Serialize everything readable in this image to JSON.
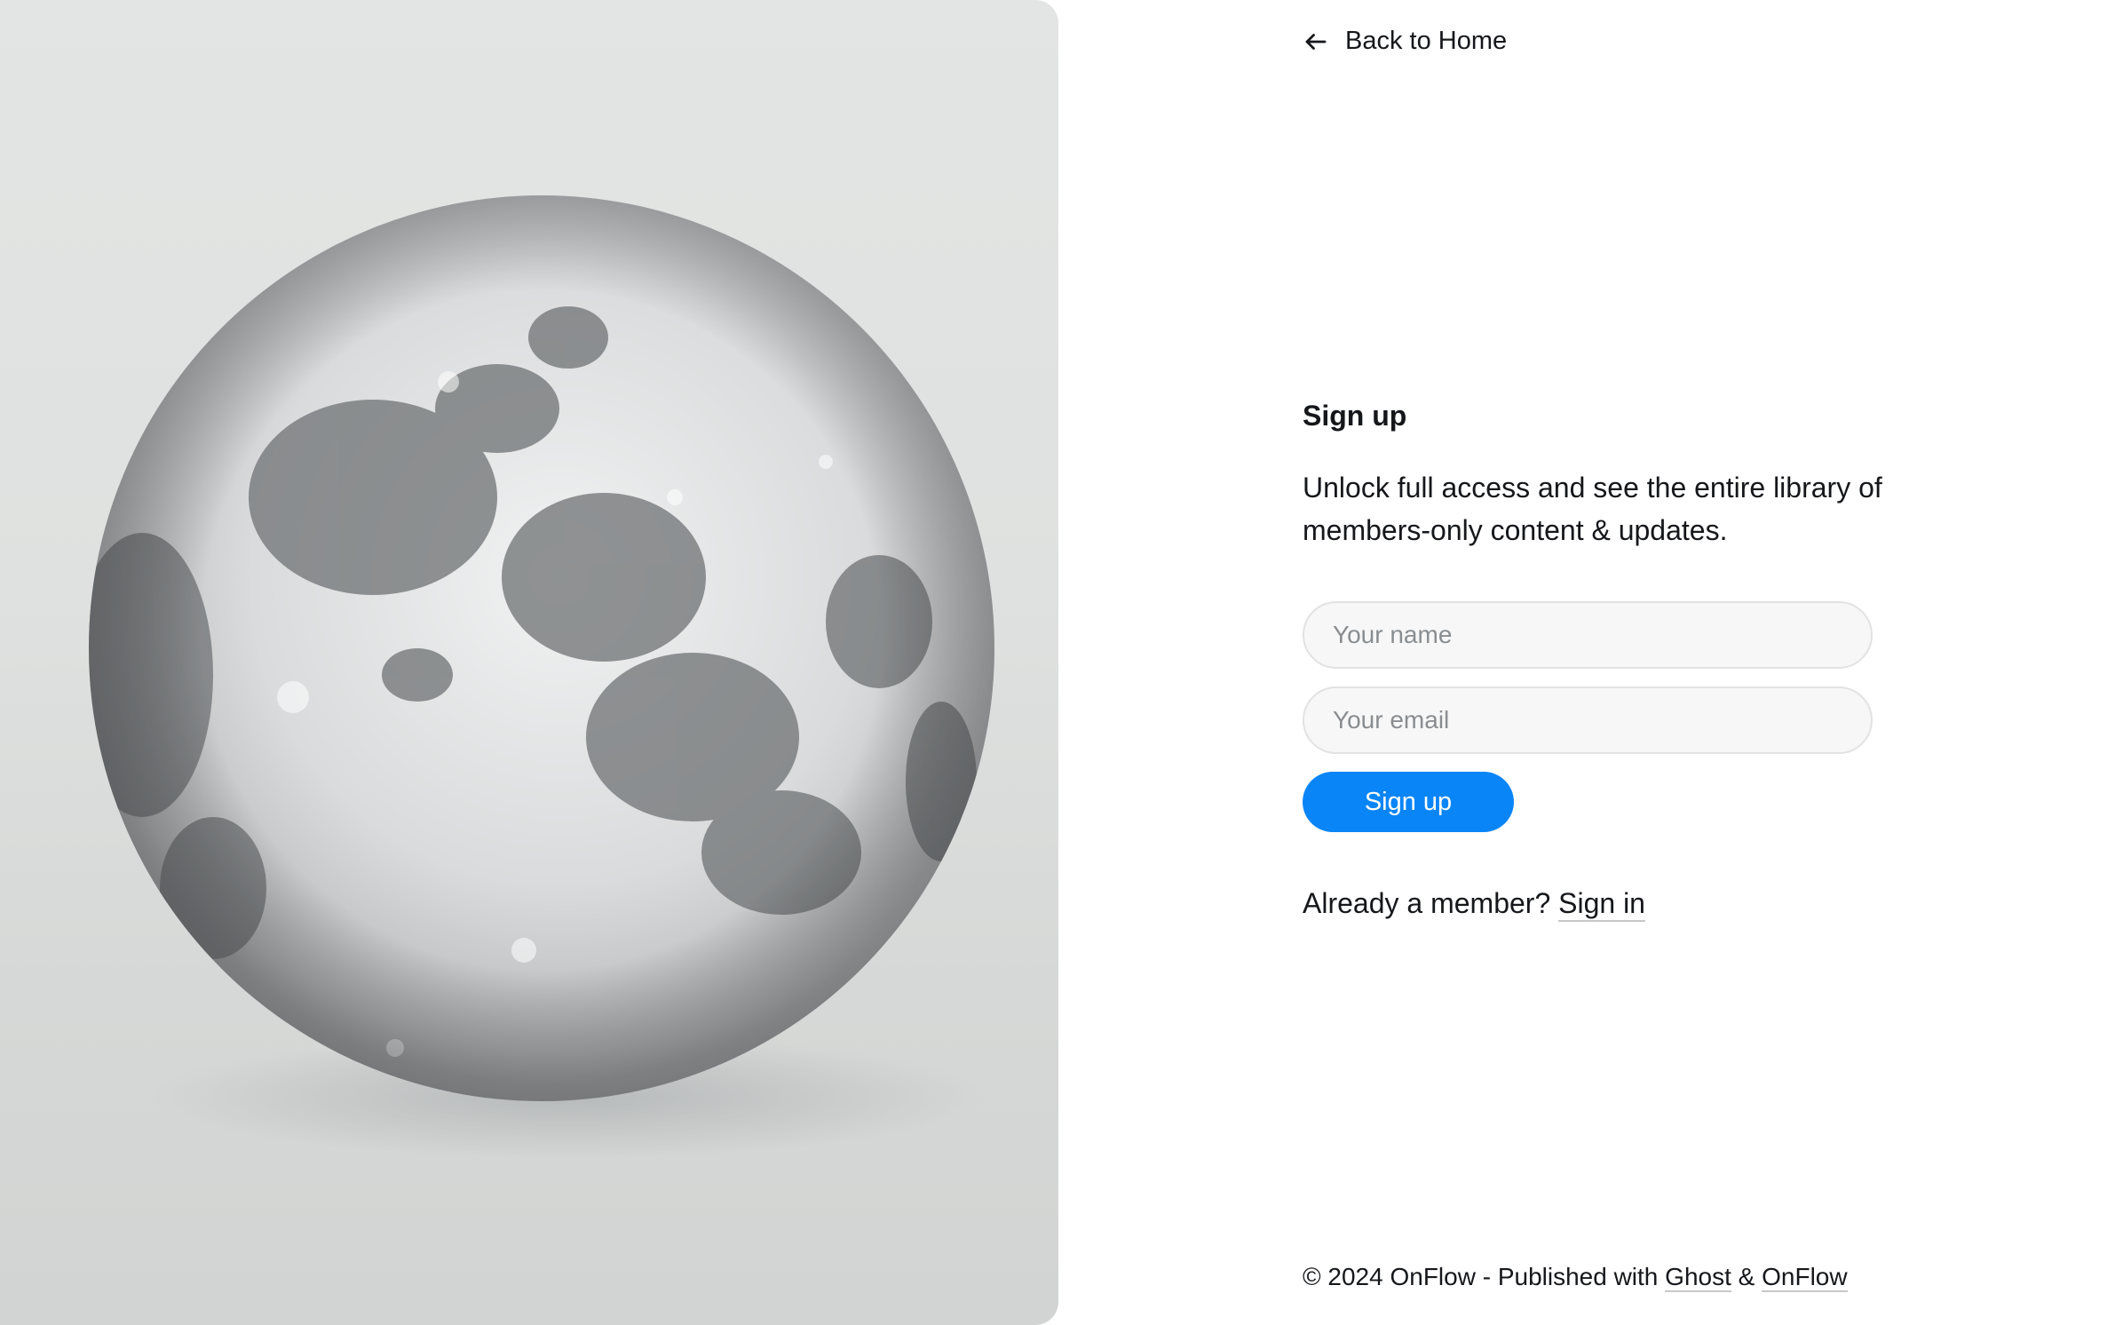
{
  "nav": {
    "back_label": "Back to Home",
    "back_icon": "arrow-left-icon"
  },
  "hero": {
    "image": "full-moon-sphere",
    "accent_color": "#0a85f7"
  },
  "signup": {
    "title": "Sign up",
    "description": "Unlock full access and see the entire library of members-only content & updates.",
    "name_placeholder": "Your name",
    "email_placeholder": "Your email",
    "submit_label": "Sign up"
  },
  "member": {
    "prompt": "Already a member?",
    "signin_label": "Sign in"
  },
  "footer": {
    "copyright": "© 2024 OnFlow - Published with",
    "ghost_label": "Ghost",
    "amp": "&",
    "onflow_label": "OnFlow"
  }
}
